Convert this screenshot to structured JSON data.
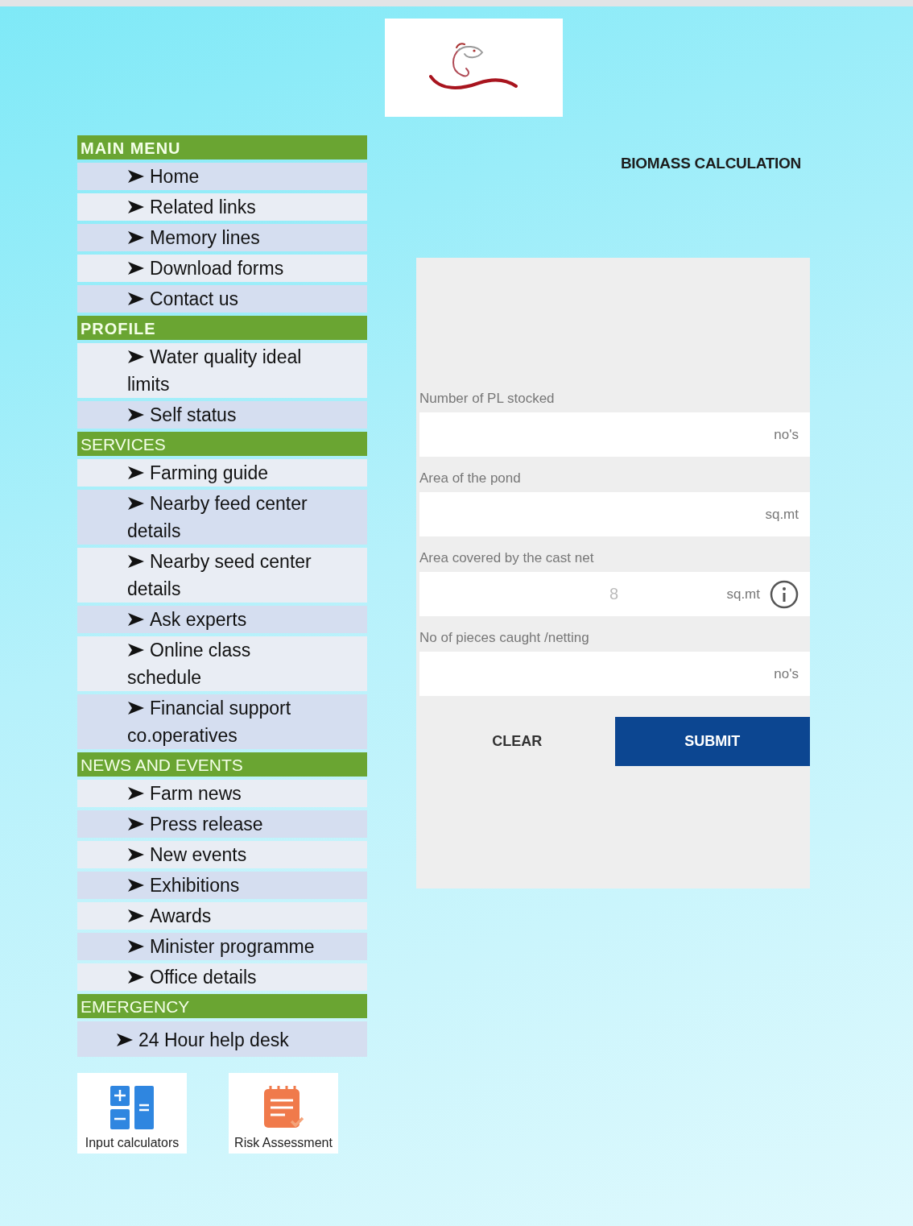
{
  "logo": {
    "kind": "fish"
  },
  "menu": [
    {
      "heading": "MAIN MENU",
      "bold": true,
      "items": [
        "Home",
        "Related links",
        "Memory lines",
        "Download forms",
        "Contact us"
      ]
    },
    {
      "heading": "PROFILE",
      "bold": true,
      "items": [
        "Water quality ideal\nlimits",
        "Self status"
      ]
    },
    {
      "heading": "SERVICES",
      "bold": false,
      "items": [
        "Farming guide",
        "Nearby feed center\ndetails",
        "Nearby seed center\ndetails",
        "Ask experts",
        "Online class\nschedule",
        "Financial support\nco.operatives"
      ]
    },
    {
      "heading": "NEWS AND EVENTS",
      "bold": false,
      "items": [
        "Farm news",
        "Press release",
        "New events",
        "Exhibitions",
        "Awards",
        "Minister programme",
        "Office details"
      ]
    },
    {
      "heading": "EMERGENCY",
      "bold": false,
      "items": [
        "24 Hour help desk"
      ]
    }
  ],
  "tiles": [
    {
      "kind": "calculator",
      "label": "Input calculators"
    },
    {
      "kind": "checklist",
      "label": "Risk Assessment"
    }
  ],
  "title": "BIOMASS CALCULATION",
  "fields": [
    {
      "label": "Number of PL stocked",
      "unit": "no's"
    },
    {
      "label": "Area of the pond",
      "unit": "sq.mt"
    },
    {
      "label": "Area covered by the cast net",
      "value": "8",
      "unit": "sq.mt",
      "info": true
    },
    {
      "label": "No of pieces caught /netting",
      "unit": "no's"
    }
  ],
  "buttons": [
    {
      "label": "CLEAR",
      "kind": "text"
    },
    {
      "label": "SUBMIT",
      "kind": "primary"
    }
  ]
}
